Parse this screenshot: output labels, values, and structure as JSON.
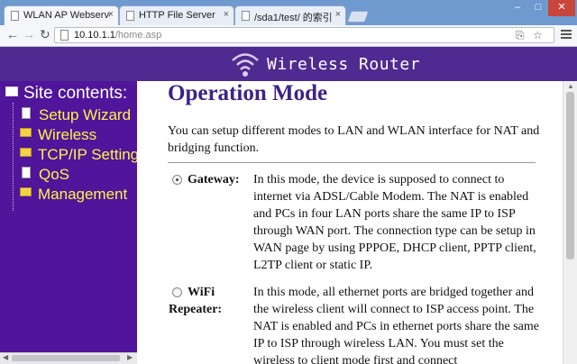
{
  "browser": {
    "tabs": [
      {
        "label": "WLAN AP Webserver",
        "close": "×"
      },
      {
        "label": "HTTP File Server",
        "close": "×"
      },
      {
        "label": "/sda1/test/ 的索引",
        "close": "×"
      }
    ],
    "window_controls": {
      "minimize": "–",
      "maximize": "□",
      "close": "✕"
    },
    "nav": {
      "back": "←",
      "forward": "→",
      "reload": "↻"
    },
    "url": {
      "host": "10.10.1.1",
      "path": "/home.asp"
    }
  },
  "header": {
    "title": "Wireless Router",
    "logo": "wifi-signal-icon"
  },
  "sidebar": {
    "title": "Site contents:",
    "items": [
      {
        "label": "Setup Wizard",
        "icon": "page-icon"
      },
      {
        "label": "Wireless",
        "icon": "folder-icon"
      },
      {
        "label": "TCP/IP Settings",
        "icon": "folder-icon"
      },
      {
        "label": "QoS",
        "icon": "page-icon"
      },
      {
        "label": "Management",
        "icon": "folder-icon"
      }
    ]
  },
  "main": {
    "title": "Operation Mode",
    "intro": "You can setup different modes to LAN and WLAN interface for NAT and bridging function.",
    "modes": [
      {
        "label": "Gateway:",
        "selected": true,
        "description": "In this mode, the device is supposed to connect to internet via ADSL/Cable Modem. The NAT is enabled and PCs in four LAN ports share the same IP to ISP through WAN port. The connection type can be setup in WAN page by using PPPOE, DHCP client, PPTP client, L2TP client or static IP."
      },
      {
        "label_line1": "WiFi",
        "label_line2": "Repeater:",
        "selected": false,
        "description": "In this mode, all ethernet ports are bridged together and the wireless client will connect to ISP access point. The NAT is enabled and PCs in ethernet ports share the same IP to ISP through wireless LAN. You must set the wireless to client mode first and connect"
      }
    ]
  },
  "colors": {
    "header_bg": "#4f2a90",
    "sidebar_bg": "#50159a",
    "sidebar_link": "#fff34a",
    "title": "#3d2387"
  }
}
